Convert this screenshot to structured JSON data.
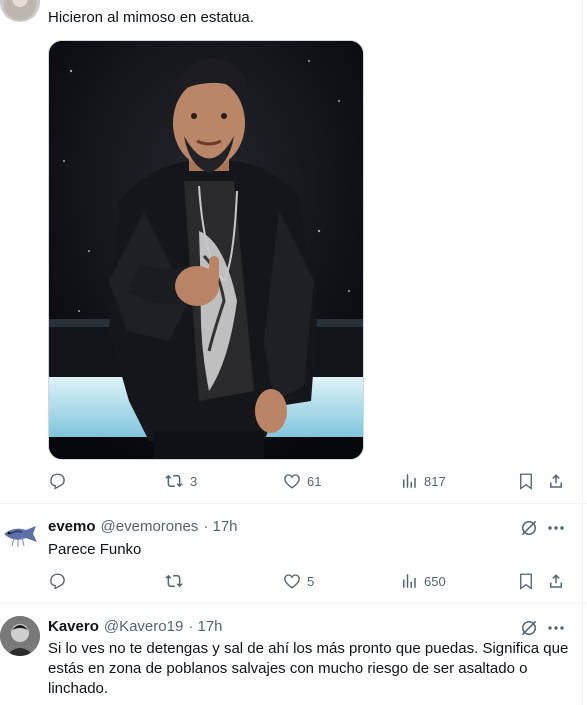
{
  "tweet1": {
    "text": "Hicieron al mimoso en estatua.",
    "actions": {
      "replies": "",
      "reposts": "3",
      "likes": "61",
      "views": "817"
    }
  },
  "tweet2": {
    "name": "evemo",
    "handle": "@evemorones",
    "time": "· 17h",
    "text": "Parece Funko",
    "actions": {
      "replies": "",
      "reposts": "",
      "likes": "5",
      "views": "650"
    }
  },
  "tweet3": {
    "name": "Kavero",
    "handle": "@Kavero19",
    "time": "· 17h",
    "text": "Si lo ves no te detengas y sal de ahí los más pronto que puedas. Significa que estás en zona de poblanos salvajes con mucho riesgo de ser asaltado o linchado."
  },
  "icons": {
    "reply": "reply-icon",
    "repost": "repost-icon",
    "like": "heart-icon",
    "views": "views-icon",
    "bookmark": "bookmark-icon",
    "share": "share-icon",
    "grok": "grok-icon",
    "more": "more-icon"
  },
  "colors": {
    "text": "#0f1419",
    "secondary": "#536471",
    "divider": "#eff3f4"
  }
}
